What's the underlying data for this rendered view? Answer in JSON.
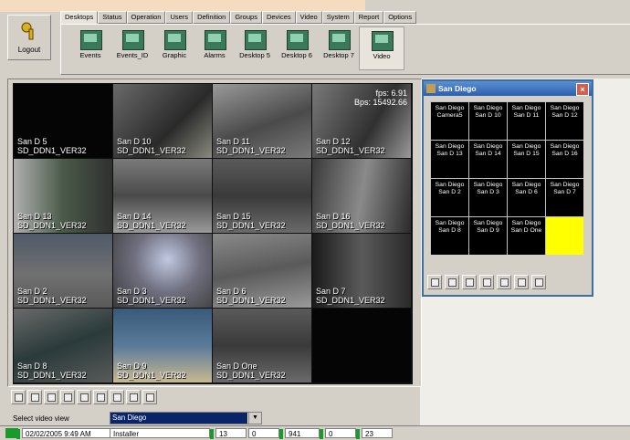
{
  "logout": {
    "label": "Logout"
  },
  "tabs": [
    "Desktops",
    "Status",
    "Operation",
    "Users",
    "Definition",
    "Groups",
    "Devices",
    "Video",
    "System",
    "Report",
    "Options"
  ],
  "toolbar": [
    "Events",
    "Events_ID",
    "Graphic",
    "Alarms",
    "Desktop 5",
    "Desktop 6",
    "Desktop 7",
    "Video"
  ],
  "video_cells": [
    {
      "name": "San D 5",
      "id": "SD_DDN1_VER32"
    },
    {
      "name": "San D 10",
      "id": "SD_DDN1_VER32"
    },
    {
      "name": "San D 11",
      "id": "SD_DDN1_VER32"
    },
    {
      "name": "San D 12",
      "id": "SD_DDN1_VER32",
      "fps": "fps: 6.91",
      "bps": "Bps: 15492.66"
    },
    {
      "name": "San D 13",
      "id": "SD_DDN1_VER32"
    },
    {
      "name": "San D 14",
      "id": "SD_DDN1_VER32"
    },
    {
      "name": "San D 15",
      "id": "SD_DDN1_VER32"
    },
    {
      "name": "San D 16",
      "id": "SD_DDN1_VER32"
    },
    {
      "name": "San D 2",
      "id": "SD_DDN1_VER32"
    },
    {
      "name": "San D 3",
      "id": "SD_DDN1_VER32"
    },
    {
      "name": "San D 6",
      "id": "SD_DDN1_VER32"
    },
    {
      "name": "San D 7",
      "id": "SD_DDN1_VER32"
    },
    {
      "name": "San D 8",
      "id": "SD_DDN1_VER32"
    },
    {
      "name": "San D 9",
      "id": "SD_DDN1_VER32"
    },
    {
      "name": "San D One",
      "id": "SD_DDN1_VER32"
    },
    {
      "name": "",
      "id": ""
    }
  ],
  "select_video_view": {
    "label": "Select video view",
    "value": "San Diego"
  },
  "status_bar": {
    "datetime": "02/02/2005 9:49 AM",
    "user": "Installer",
    "v1": "13",
    "v2": "0",
    "v3": "941",
    "v4": "0",
    "v5": "23"
  },
  "sd_window": {
    "title": "San Diego",
    "close": "×",
    "cells": [
      [
        "San Diego",
        "Camera5"
      ],
      [
        "San Diego",
        "San D 10"
      ],
      [
        "San Diego",
        "San D 11"
      ],
      [
        "San Diego",
        "San D 12"
      ],
      [
        "San Diego",
        "San D 13"
      ],
      [
        "San Diego",
        "San D 14"
      ],
      [
        "San Diego",
        "San D 15"
      ],
      [
        "San Diego",
        "San D 16"
      ],
      [
        "San Diego",
        "San D 2"
      ],
      [
        "San Diego",
        "San D 3"
      ],
      [
        "San Diego",
        "San D 6"
      ],
      [
        "San Diego",
        "San D 7"
      ],
      [
        "San Diego",
        "San D 8"
      ],
      [
        "San Diego",
        "San D 9"
      ],
      [
        "San Diego",
        "San D One"
      ],
      [
        "",
        ""
      ]
    ]
  },
  "colors": {
    "accent": "#0a246a",
    "title_bar": "#2b5fb0",
    "highlight_cell": "#ffff00",
    "status_led": "#1a9a2a"
  }
}
